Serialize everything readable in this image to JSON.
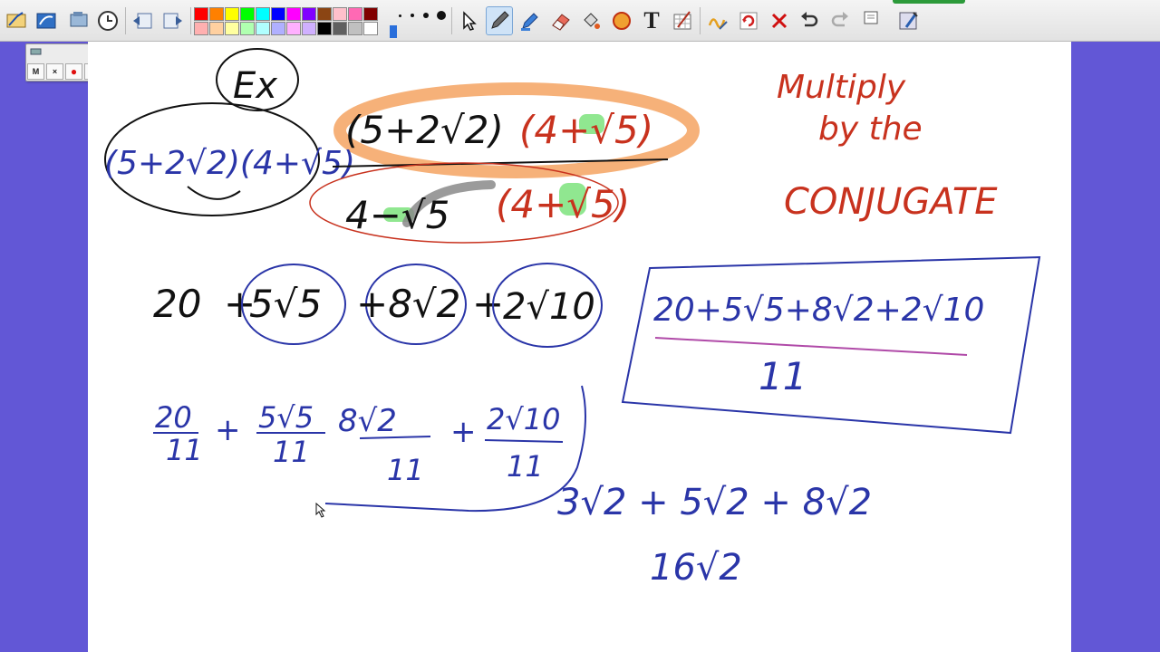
{
  "toolbar": {
    "tools": [
      "pen-tool-icon",
      "highlighter-icon",
      "screen-capture-icon",
      "timer-icon",
      "back-icon",
      "forward-icon",
      "select-arrow-icon",
      "pen-icon",
      "marker-icon",
      "eraser-icon",
      "fill-icon",
      "shapes-icon",
      "text-icon",
      "grid-icon",
      "handwriting-icon",
      "refresh-icon",
      "delete-icon",
      "undo-icon",
      "redo-icon",
      "page-icon",
      "settings-icon"
    ],
    "palette_top": [
      "#ff0000",
      "#ff8000",
      "#ffff00",
      "#00ff00",
      "#00ffff",
      "#0000ff",
      "#ff00ff",
      "#8000ff",
      "#8b4513",
      "#ffc0cb",
      "#ff69b4",
      "#800000"
    ],
    "palette_bottom": [
      "#ffb0b0",
      "#ffd0a0",
      "#ffffa0",
      "#b0ffb0",
      "#b0ffff",
      "#b0b0ff",
      "#ffb0ff",
      "#d0b0ff",
      "#000000",
      "#606060",
      "#c0c0c0",
      "#ffffff"
    ],
    "text_tool_label": "T"
  },
  "recorder": {
    "buttons": [
      "M",
      "×",
      "●",
      "II",
      "■",
      "▶"
    ]
  },
  "board": {
    "ex_label": "Ex",
    "problem_left": "(5+2√2)(4+√5)",
    "numerator": "(5+2√2)",
    "numerator_conj": "(4+√5)",
    "denominator": "4−√5",
    "denominator_conj": "(4+√5)",
    "note_line1": "Multiply",
    "note_line2": "by the",
    "note_line3": "CONJUGATE",
    "expansion_terms": [
      "20",
      "+",
      "5√5",
      "+8√2",
      "+",
      "2√10"
    ],
    "boxed_numerator": "20+5√5+8√2+2√10",
    "boxed_denominator": "11",
    "split_fracs": [
      {
        "num": "20",
        "den": "11"
      },
      {
        "num": "5√5",
        "den": "11"
      },
      {
        "num": "8√2",
        "den": "11"
      },
      {
        "num": "2√10",
        "den": "11"
      }
    ],
    "side_work_line1": "3√2 + 5√2 + 8√2",
    "side_work_line2": "16√2"
  },
  "colors": {
    "blue_ink": "#2a35a8",
    "red_ink": "#c8321e",
    "black_ink": "#111111",
    "orange_highlight": "#f5a86a",
    "green_highlight": "#7de37d",
    "gray_stroke": "#8a8a8a"
  }
}
